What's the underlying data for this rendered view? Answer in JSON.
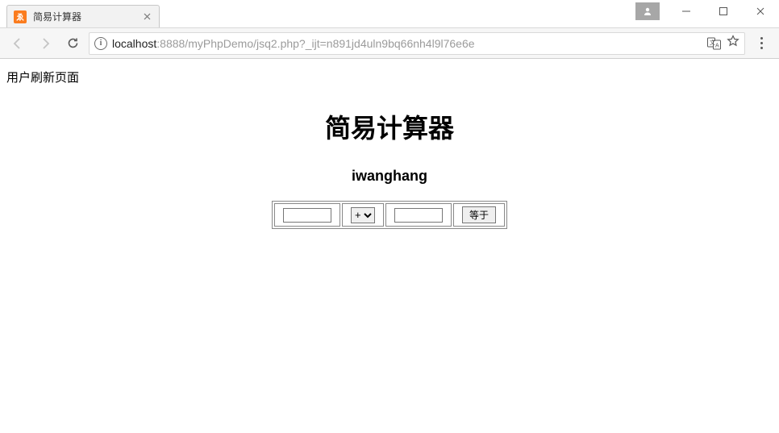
{
  "window": {
    "tab_title": "简易计算器",
    "url_prefix": "localhost",
    "url_rest": ":8888/myPhpDemo/jsq2.php?_ijt=n891jd4uln9bq66nh4l9l76e6e"
  },
  "page": {
    "refresh_message": "用户刷新页面",
    "heading": "简易计算器",
    "author": "iwanghang"
  },
  "calc": {
    "num1": "",
    "num2": "",
    "operator_selected": "+",
    "operators": [
      "+"
    ],
    "equals_label": "等于"
  }
}
